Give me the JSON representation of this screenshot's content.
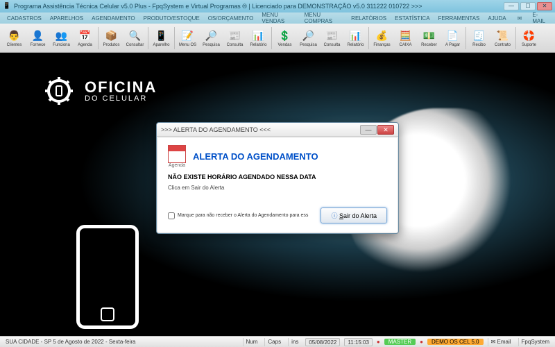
{
  "titlebar": {
    "text": "Programa Assistência Técnica Celular v5.0 Plus - FpqSystem e Virtual Programas ® | Licenciado para  DEMONSTRAÇÃO v5.0 311222 010722 >>>"
  },
  "menubar": {
    "items": [
      "CADASTROS",
      "APARELHOS",
      "AGENDAMENTO",
      "PRODUTO/ESTOQUE",
      "OS/ORÇAMENTO",
      "MENU VENDAS",
      "MENU COMPRAS",
      "RELATÓRIOS",
      "ESTATÍSTICA",
      "FERRAMENTAS",
      "AJUDA"
    ],
    "email": "E-MAIL"
  },
  "toolbar": {
    "items": [
      {
        "label": "Clientes",
        "icon": "👨"
      },
      {
        "label": "Fornece",
        "icon": "👤"
      },
      {
        "label": "Funciona",
        "icon": "👥"
      },
      {
        "label": "Agenda",
        "icon": "📅"
      },
      {
        "label": "Produtos",
        "icon": "📦"
      },
      {
        "label": "Consultar",
        "icon": "🔍"
      },
      {
        "label": "Aparelho",
        "icon": "📱"
      },
      {
        "label": "Menu OS",
        "icon": "📝"
      },
      {
        "label": "Pesquisa",
        "icon": "🔎"
      },
      {
        "label": "Consulta",
        "icon": "📰"
      },
      {
        "label": "Relatório",
        "icon": "📊"
      },
      {
        "label": "Vendas",
        "icon": "💲"
      },
      {
        "label": "Pesquisa",
        "icon": "🔎"
      },
      {
        "label": "Consulta",
        "icon": "📰"
      },
      {
        "label": "Relatório",
        "icon": "📊"
      },
      {
        "label": "Finanças",
        "icon": "💰"
      },
      {
        "label": "CAIXA",
        "icon": "🧮"
      },
      {
        "label": "Receber",
        "icon": "💵"
      },
      {
        "label": "A Pagar",
        "icon": "📄"
      },
      {
        "label": "Recibo",
        "icon": "🧾"
      },
      {
        "label": "Contrato",
        "icon": "📜"
      },
      {
        "label": "Suporte",
        "icon": "🛟"
      }
    ],
    "separators_after": [
      3,
      5,
      6,
      10,
      14,
      18,
      20
    ]
  },
  "logo": {
    "line1": "OFICINA",
    "line2": "DO CELULAR"
  },
  "dialog": {
    "title": ">>> ALERTA DO AGENDAMENTO <<<",
    "agenda_label": "Agenda",
    "heading": "ALERTA DO AGENDAMENTO",
    "message1": "NÃO EXISTE HORÁRIO AGENDADO NESSA DATA",
    "message2": "Clica em Sair do Alerta",
    "checkbox": "Marque para não receber o Alerta do Agendamento para ess",
    "button_text": "air do Alerta",
    "button_underline": "S"
  },
  "statusbar": {
    "location": "SUA CIDADE - SP  5 de Agosto de 2022 - Sexta-feira",
    "num": "Num",
    "caps": "Caps",
    "ins": "ins",
    "date": "05/08/2022",
    "time": "11:15:03",
    "master": "MASTER",
    "demo": "DEMO OS CEL 5.0",
    "email": "Email",
    "fpq": "FpqSystem"
  }
}
